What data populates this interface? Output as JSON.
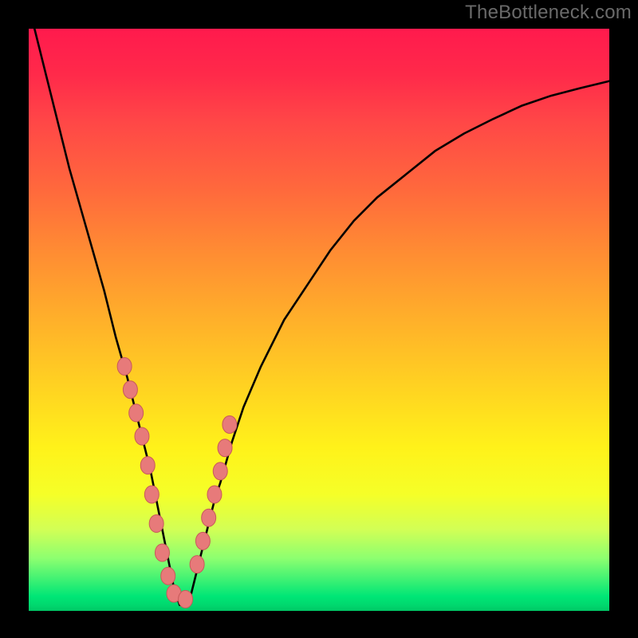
{
  "watermark": "TheBottleneck.com",
  "colors": {
    "frame": "#000000",
    "curve": "#000000",
    "marker_fill": "#e77a7a",
    "marker_stroke": "#c85a5a",
    "gradient_stops": [
      "#ff1a4d",
      "#ff4747",
      "#ff8b33",
      "#ffd421",
      "#fff21a",
      "#8cff70",
      "#00d86e"
    ]
  },
  "chart_data": {
    "type": "line",
    "title": "",
    "xlabel": "",
    "ylabel": "",
    "xlim": [
      0,
      100
    ],
    "ylim": [
      0,
      100
    ],
    "x_min_at": 26,
    "series": [
      {
        "name": "bottleneck-curve",
        "x": [
          1,
          3,
          5,
          7,
          9,
          11,
          13,
          15,
          17,
          18,
          19,
          20,
          21,
          22,
          23,
          24,
          25,
          26,
          27,
          28,
          29,
          30,
          31,
          32,
          33,
          35,
          37,
          40,
          44,
          48,
          52,
          56,
          60,
          65,
          70,
          75,
          80,
          85,
          90,
          95,
          100
        ],
        "y": [
          100,
          92,
          84,
          76,
          69,
          62,
          55,
          47,
          40,
          36,
          32,
          28,
          24,
          19,
          14,
          9,
          4,
          1,
          1,
          3,
          7,
          11,
          15,
          19,
          22,
          29,
          35,
          42,
          50,
          56,
          62,
          67,
          71,
          75,
          79,
          82,
          84.5,
          86.8,
          88.5,
          89.8,
          91
        ]
      }
    ],
    "markers": {
      "name": "highlighted-points",
      "x": [
        16.5,
        17.5,
        18.5,
        19.5,
        20.5,
        21.2,
        22,
        23,
        24,
        25,
        27,
        29,
        30,
        31,
        32,
        33,
        33.8,
        34.6
      ],
      "y": [
        42,
        38,
        34,
        30,
        25,
        20,
        15,
        10,
        6,
        3,
        2,
        8,
        12,
        16,
        20,
        24,
        28,
        32
      ]
    }
  }
}
